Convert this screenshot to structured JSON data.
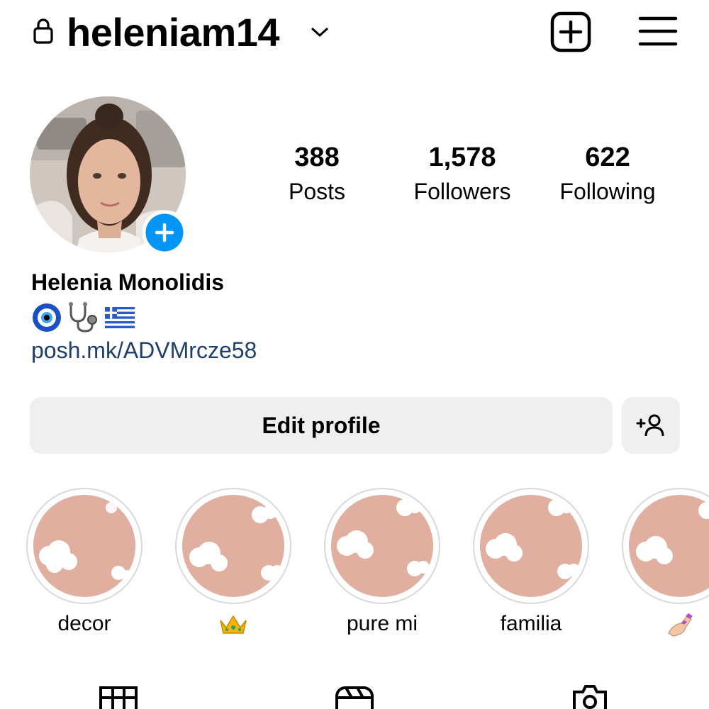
{
  "header": {
    "username": "heleniam14",
    "icons": [
      "lock-icon",
      "chevron-down-icon",
      "plus-square-icon",
      "hamburger-menu-icon"
    ]
  },
  "stats": [
    {
      "value": "388",
      "label": "Posts"
    },
    {
      "value": "1,578",
      "label": "Followers"
    },
    {
      "value": "622",
      "label": "Following"
    }
  ],
  "profile": {
    "full_name": "Helenia Monolidis",
    "bio_emoji": [
      "nazar-amulet",
      "stethoscope",
      "greek-flag"
    ],
    "link": "posh.mk/ADVMrcze58"
  },
  "actions": {
    "edit_profile": "Edit profile"
  },
  "highlights": [
    {
      "label": "decor"
    },
    {
      "label": "👑"
    },
    {
      "label": "pure mi"
    },
    {
      "label": "familia"
    },
    {
      "label": "💅"
    }
  ],
  "tabs": [
    "grid-icon",
    "reels-icon",
    "tagged-icon"
  ],
  "colors": {
    "accent_blue": "#0095f6",
    "button_bg": "#efefef",
    "link": "#1f3e6a",
    "highlight_cover": "#e0afa0"
  }
}
